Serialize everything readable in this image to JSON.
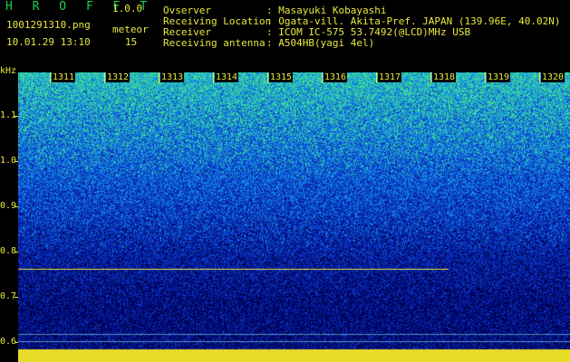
{
  "header": {
    "app_title": "H R O F F T",
    "version": "1.0.0",
    "filename": "1001291310.png",
    "datetime": "10.01.29 13:10",
    "meteor_label": "meteor",
    "meteor_count": "15",
    "observer_label": "Ovserver",
    "observer_value": ": Masayuki Kobayashi",
    "location_label": "Receiving Location",
    "location_value": ": Ogata-vill. Akita-Pref. JAPAN (139.96E, 40.02N)",
    "receiver_label": "Receiver",
    "receiver_value": ": ICOM IC-575 53.7492(@LCD)MHz USB",
    "antenna_label": "Receiving antenna",
    "antenna_value": ": A504HB(yagi 4el)"
  },
  "axis": {
    "y_unit": "kHz",
    "y_ticks": [
      "1.1",
      "1.0",
      "0.9",
      "0.8",
      "0.7",
      "0.6"
    ],
    "x_ticks": [
      "1311",
      "1312",
      "1313",
      "1314",
      "1315",
      "1316",
      "1317",
      "1318",
      "1319",
      "1320"
    ]
  },
  "colors": {
    "background": "#000000",
    "text": "#e8e840",
    "title": "#1fd24a",
    "trace": "#e8e840"
  }
}
